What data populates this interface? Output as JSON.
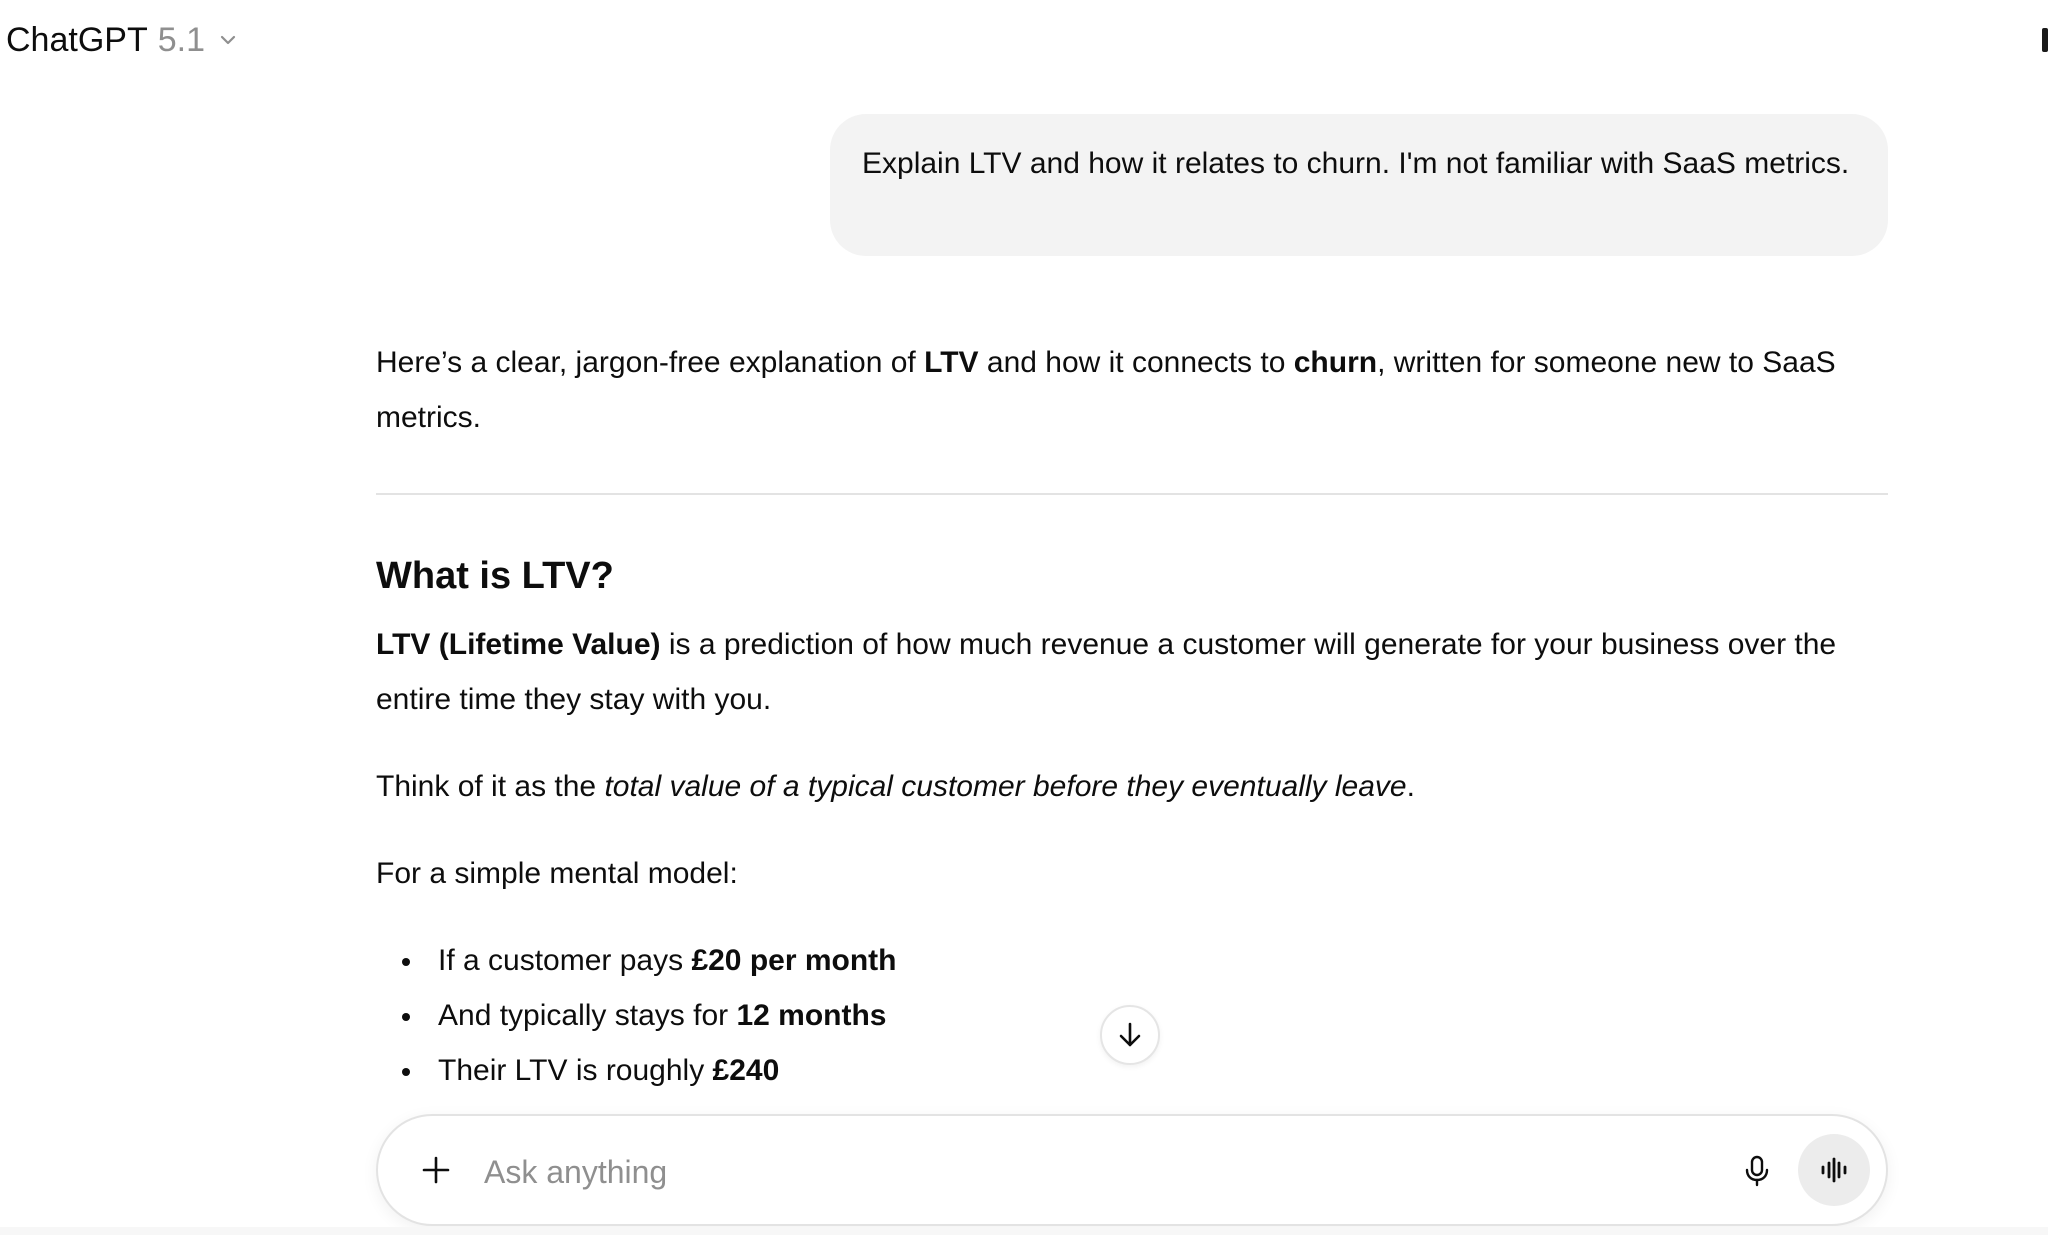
{
  "header": {
    "model_name": "ChatGPT",
    "model_version": "5.1",
    "chevron_icon": "chevron-down-icon"
  },
  "conversation": {
    "user_message": "Explain LTV and how it relates to churn. I'm not familiar with SaaS metrics.",
    "assistant": {
      "intro": {
        "t1": "Here’s a clear, jargon-free explanation of ",
        "b1": "LTV",
        "t2": " and how it connects to ",
        "b2": "churn",
        "t3": ", written for someone new to SaaS metrics."
      },
      "heading": "What is LTV?",
      "definition": {
        "b1": "LTV (Lifetime Value)",
        "t1": " is a prediction of how much revenue a customer will generate for your business over the entire time they stay with you."
      },
      "think": {
        "t1": "Think of it as the ",
        "i1": "total value of a typical customer before they eventually leave",
        "t2": "."
      },
      "mental_model_intro": "For a simple mental model:",
      "bullets": [
        {
          "text": "If a customer pays ",
          "bold": "£20 per month"
        },
        {
          "text": "And typically stays for ",
          "bold": "12 months"
        },
        {
          "text": "Their LTV is roughly ",
          "bold": "£240"
        }
      ]
    }
  },
  "composer": {
    "placeholder": "Ask anything",
    "value": "",
    "plus_icon": "plus-icon",
    "mic_icon": "microphone-icon",
    "voice_icon": "voice-mode-icon"
  },
  "scroll": {
    "icon": "arrow-down-icon"
  },
  "colors": {
    "text": "#0d0d0d",
    "muted": "#8f8f8f",
    "bubble": "#f3f3f3",
    "border": "#e3e3e3",
    "voice_button": "#ececec"
  }
}
